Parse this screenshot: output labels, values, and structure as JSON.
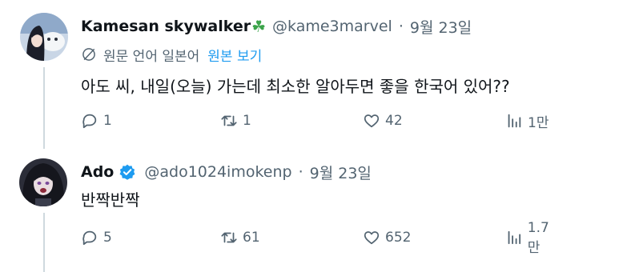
{
  "tweets": [
    {
      "name": "Kamesan skywalker",
      "handle": "@kame3marvel",
      "separator": "·",
      "date": "9월 23일",
      "translated_from": "원문 언어 일본어",
      "show_original": "원본 보기",
      "text": "아도 씨, 내일(오늘) 가는데 최소한 알아두면 좋을 한국어 있어??",
      "replies": "1",
      "retweets": "1",
      "likes": "42",
      "views": "1만"
    },
    {
      "name": "Ado",
      "handle": "@ado1024imokenp",
      "separator": "·",
      "date": "9월 23일",
      "text": "반짝반짝",
      "replies": "5",
      "retweets": "61",
      "likes": "652",
      "views": "1.7만"
    }
  ],
  "icons": {
    "name_emoji": "shamrock-icon",
    "verified": "verified-badge-icon",
    "translate": "globe-off-icon",
    "reply": "reply-icon",
    "retweet": "retweet-icon",
    "like": "heart-icon",
    "views": "views-icon"
  },
  "colors": {
    "link": "#1d9bf0",
    "secondary_text": "#536471",
    "verified": "#1d9bf0",
    "thread_line": "#cfd9de"
  }
}
